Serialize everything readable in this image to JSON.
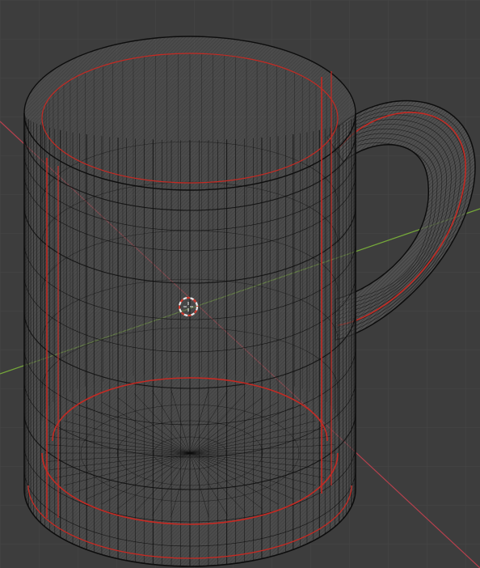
{
  "viewport": {
    "view": "3d-viewport-wireframe",
    "background_color": "#3d3d3d",
    "grid_color": "#474747",
    "object": {
      "name_shown": "",
      "shape": "mug",
      "wire_color": "#0d0d0d",
      "face_color": "#585858",
      "seam_color": "#c42a23"
    },
    "axes": {
      "x_axis_color": "#b5404d",
      "y_axis_color": "#76a93a"
    },
    "cursor": {
      "icon": "3d-cursor-icon",
      "ring_color_a": "#e8e8e8",
      "ring_color_b": "#d23b2f"
    }
  }
}
